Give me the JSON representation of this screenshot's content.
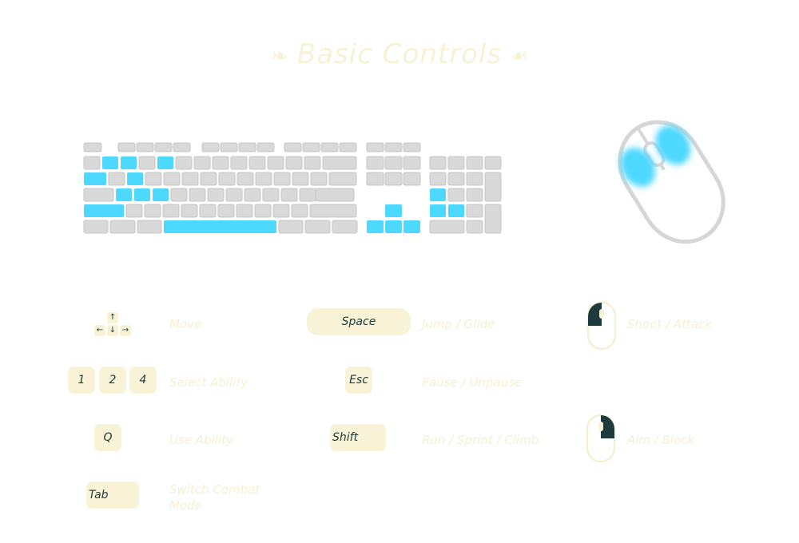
{
  "title": "Basic Controls",
  "title_ornament_left": "❧",
  "title_ornament_right": "❧",
  "colors": {
    "highlight": "#4dd8ff",
    "key": "#d9d9d9",
    "keycap_bg": "#f8f3d6",
    "text_dark": "#1f3a3a",
    "label_text": "#f5f0d2"
  },
  "keyboard_highlights": [
    "2",
    "3",
    "5",
    "Q",
    "E",
    "S",
    "D",
    "F",
    "Shift",
    "Space",
    "Arrows",
    "Numpad-4",
    "Numpad-1",
    "Numpad-2"
  ],
  "arrow_keys": {
    "up": "↑",
    "left": "←",
    "down": "↓",
    "right": "→"
  },
  "controls": [
    {
      "id": "move",
      "keys": [
        "↑",
        "←",
        "↓",
        "→"
      ],
      "label": "Move"
    },
    {
      "id": "select-ability",
      "keys": [
        "1",
        "2",
        "4"
      ],
      "label": "Select Ability"
    },
    {
      "id": "use-ability",
      "keys": [
        "Q"
      ],
      "label": "Use Ability"
    },
    {
      "id": "switch-combat",
      "keys": [
        "Tab"
      ],
      "label": "Switch Combat Mode"
    },
    {
      "id": "jump",
      "keys": [
        "Space"
      ],
      "label": "Jump / Glide"
    },
    {
      "id": "pause",
      "keys": [
        "Esc"
      ],
      "label": "Pause / Unpause"
    },
    {
      "id": "run",
      "keys": [
        "Shift"
      ],
      "label": "Run / Sprint / Climb"
    },
    {
      "id": "shoot",
      "keys": [
        "left-mouse-button"
      ],
      "label": "Shoot / Attack"
    },
    {
      "id": "aim",
      "keys": [
        "right-mouse-button"
      ],
      "label": "Aim / Block"
    }
  ]
}
